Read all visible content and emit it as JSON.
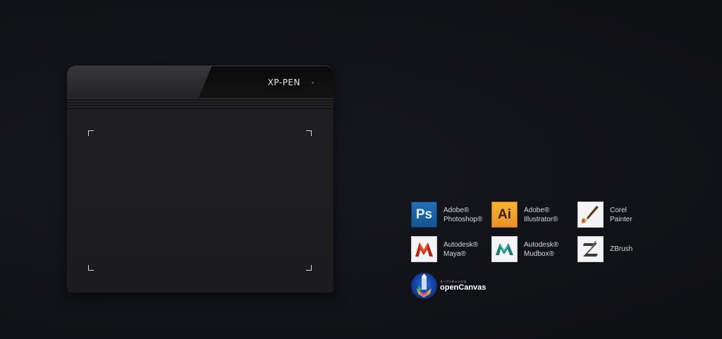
{
  "tablet": {
    "brand": "XP-PEN"
  },
  "software": [
    {
      "id": "photoshop",
      "icon": "photoshop-icon",
      "icon_text": "Ps",
      "label": "Adobe®\nPhotoshop®"
    },
    {
      "id": "illustrator",
      "icon": "illustrator-icon",
      "icon_text": "Ai",
      "label": "Adobe®\nIllustrator®"
    },
    {
      "id": "painter",
      "icon": "corel-painter-icon",
      "label": "Corel\nPainter"
    },
    {
      "id": "maya",
      "icon": "autodesk-maya-icon",
      "label": "Autodesk®\nMaya®"
    },
    {
      "id": "mudbox",
      "icon": "autodesk-mudbox-icon",
      "label": "Autodesk®\nMudbox®"
    },
    {
      "id": "zbrush",
      "icon": "zbrush-icon",
      "label": "ZBrush"
    },
    {
      "id": "opencanvas",
      "icon": "opencanvas-icon",
      "small_text": "オープンキャンバス",
      "label": "openCanvas"
    }
  ],
  "colors": {
    "background": "#111217",
    "tablet_body": "#1c1c1e",
    "text": "#d8d8d8",
    "photoshop": "#1f6fb8",
    "illustrator": "#f0a22b"
  }
}
